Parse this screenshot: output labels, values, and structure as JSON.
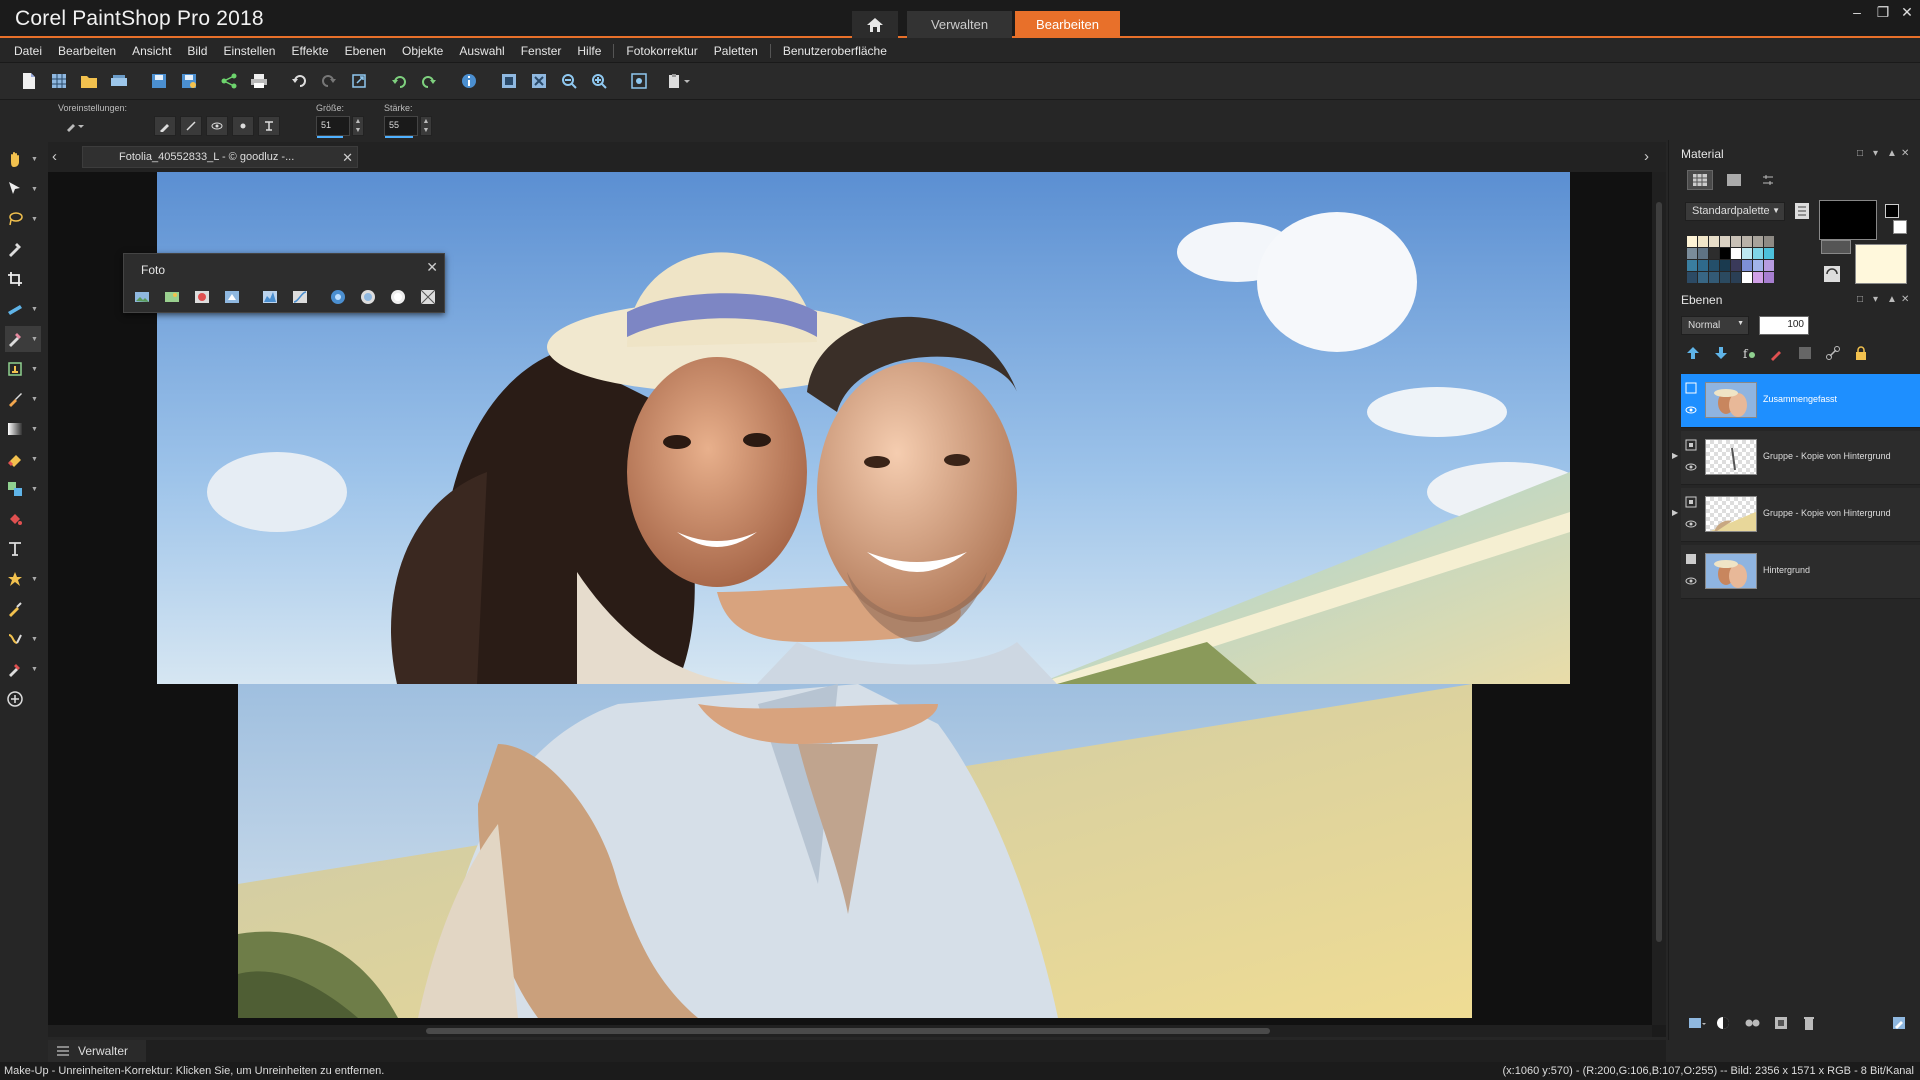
{
  "app": {
    "title": "Corel PaintShop Pro 2018",
    "tabs": [
      "Verwalten",
      "Bearbeiten"
    ],
    "active_tab": "Bearbeiten",
    "accent_color": "#e8702a"
  },
  "menu": [
    "Datei",
    "Bearbeiten",
    "Ansicht",
    "Bild",
    "Einstellen",
    "Effekte",
    "Ebenen",
    "Objekte",
    "Auswahl",
    "Fenster",
    "Hilfe",
    "Fotokorrektur",
    "Paletten",
    "Benutzeroberfläche"
  ],
  "tool_options": {
    "presets_label": "Voreinstellungen:",
    "size_label": "Größe:",
    "size_value": "51",
    "strength_label": "Stärke:",
    "strength_value": "55"
  },
  "document": {
    "tab_name": "Fotolia_40552833_L - © goodluz -..."
  },
  "foto_palette": {
    "title": "Foto"
  },
  "material_panel": {
    "title": "Material",
    "palette_select": "Standardpalette",
    "swatches": [
      "#fff4d6",
      "#f1e6c8",
      "#e7ddc8",
      "#d9d0c2",
      "#c9c1b6",
      "#b9b2a8",
      "#a8a39b",
      "#8e8a84",
      "#7a8c9a",
      "#5f7384",
      "#2d2d2d",
      "#000000",
      "#ffffff",
      "#bde9f2",
      "#7fd6e8",
      "#4cc1dc",
      "#3a7ea0",
      "#2f6a8c",
      "#244f6a",
      "#1a3a4f",
      "#3a3a5a",
      "#7d8fd6",
      "#a1b4ea",
      "#b79ce0",
      "#2c4a64",
      "#386684",
      "#335a75",
      "#2b4a60",
      "#2a3f55",
      "#ffffff",
      "#d0a0e6",
      "#a77ed0"
    ]
  },
  "layers_panel": {
    "title": "Ebenen",
    "blend_mode": "Normal",
    "opacity": "100",
    "layers": [
      {
        "name": "Zusammengefasst",
        "selected": true
      },
      {
        "name": "Gruppe - Kopie von Hintergrund",
        "selected": false
      },
      {
        "name": "Gruppe - Kopie von Hintergrund",
        "selected": false
      },
      {
        "name": "Hintergrund",
        "selected": false
      }
    ]
  },
  "bottom_tab": "Verwalter",
  "status": {
    "message": "Make-Up - Unreinheiten-Korrektur: Klicken Sie, um Unreinheiten zu entfernen.",
    "info": "(x:1060 y:570) - (R:200,G:106,B:107,O:255) -- Bild: 2356 x 1571 x RGB - 8 Bit/Kanal"
  }
}
